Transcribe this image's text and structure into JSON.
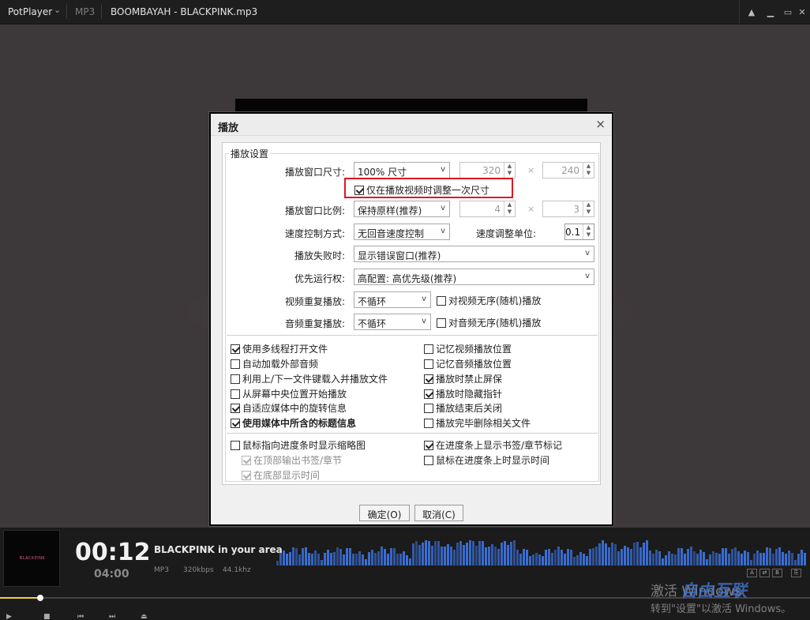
{
  "titlebar": {
    "app_name": "PotPlayer",
    "format": "MP3",
    "file_name": "BOOMBAYAH - BLACKPINK.mp3",
    "icons": [
      "chevron-down-icon",
      "pin-icon",
      "minimize-icon",
      "restore-icon",
      "close-icon"
    ]
  },
  "dialog": {
    "title": "播放",
    "close_glyph": "×",
    "group_label": "播放设置",
    "window_size": {
      "label": "播放窗口尺寸:",
      "value": "100% 尺寸",
      "width": "320",
      "height": "240"
    },
    "resize_once": {
      "label": "仅在播放视频时调整一次尺寸",
      "checked": true
    },
    "window_ratio": {
      "label": "播放窗口比例:",
      "value": "保持原样(推荐)",
      "w": "4",
      "h": "3"
    },
    "speed_mode": {
      "label": "速度控制方式:",
      "value": "无回音速度控制"
    },
    "speed_unit": {
      "label": "速度调整单位:",
      "value": "0.1"
    },
    "play_fail": {
      "label": "播放失败时:",
      "value": "显示错误窗口(推荐)"
    },
    "priority": {
      "label": "优先运行权:",
      "value": "高配置: 高优先级(推荐)"
    },
    "video_repeat": {
      "label": "视频重复播放:",
      "value": "不循环",
      "shuffle_label": "对视频无序(随机)播放",
      "shuffle_checked": false
    },
    "audio_repeat": {
      "label": "音频重复播放:",
      "value": "不循环",
      "shuffle_label": "对音频无序(随机)播放",
      "shuffle_checked": false
    },
    "options_left": [
      {
        "label": "使用多线程打开文件",
        "checked": true
      },
      {
        "label": "自动加载外部音频",
        "checked": false
      },
      {
        "label": "利用上/下一文件键载入并播放文件",
        "checked": false
      },
      {
        "label": "从屏幕中央位置开始播放",
        "checked": false
      },
      {
        "label": "自适应媒体中的旋转信息",
        "checked": true
      },
      {
        "label": "使用媒体中所含的标题信息",
        "checked": true
      }
    ],
    "options_right": [
      {
        "label": "记忆视频播放位置",
        "checked": false
      },
      {
        "label": "记忆音频播放位置",
        "checked": false
      },
      {
        "label": "播放时禁止屏保",
        "checked": true
      },
      {
        "label": "播放时隐藏指针",
        "checked": true
      },
      {
        "label": "播放结束后关闭",
        "checked": false
      },
      {
        "label": "播放完毕删除相关文件",
        "checked": false
      }
    ],
    "seek_left": [
      {
        "label": "鼠标指向进度条时显示缩略图",
        "checked": false
      },
      {
        "label": "在顶部输出书签/章节",
        "checked": true,
        "disabled": true
      },
      {
        "label": "在底部显示时间",
        "checked": true,
        "disabled": true
      }
    ],
    "seek_right": [
      {
        "label": "在进度条上显示书签/章节标记",
        "checked": true
      },
      {
        "label": "鼠标在进度条上时显示时间",
        "checked": false
      }
    ],
    "ok_label": "确定(O)",
    "cancel_label": "取消(C)"
  },
  "player": {
    "cover_text": "BLACKPINK",
    "current_time": "00:12",
    "duration": "04:00",
    "song_title": "BLACKPINK in your area",
    "format": "MP3",
    "bitrate": "320kbps",
    "sample_rate": "44.1khz",
    "progress": 0.05,
    "mini_buttons": [
      "A",
      "⇄",
      "B",
      "⎘"
    ],
    "accent": "#f0d040",
    "viz_color": "#3a6fd8"
  },
  "watermark": {
    "line1": "激活 Windows",
    "line2": "转到\"设置\"以激活 Windows。",
    "logo": "自由互联"
  }
}
